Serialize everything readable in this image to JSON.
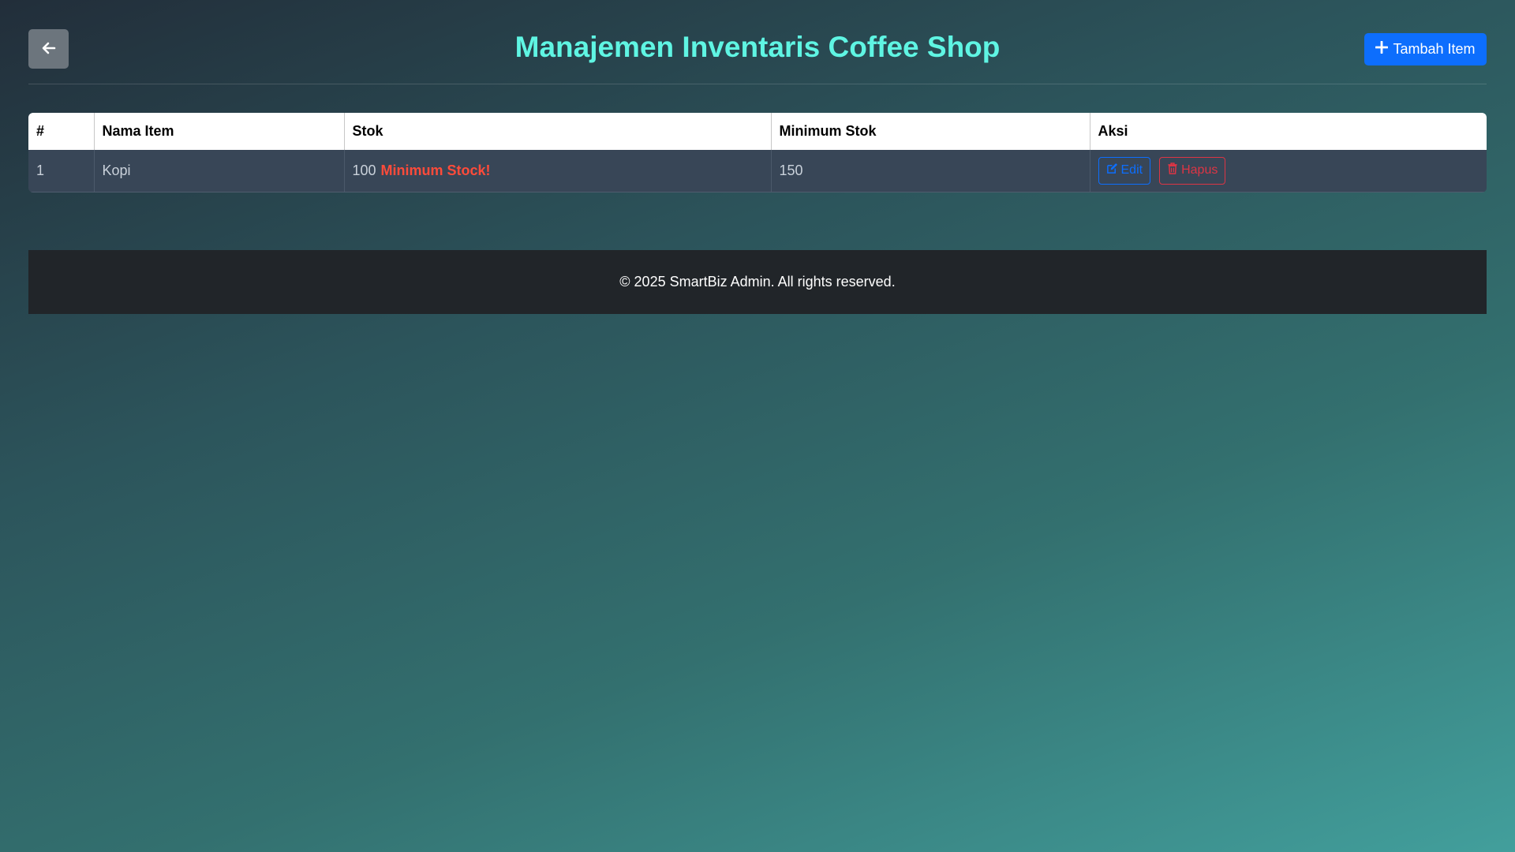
{
  "header": {
    "title": "Manajemen Inventaris Coffee Shop",
    "back_icon": "arrow-left-icon",
    "add_icon": "plus-icon",
    "add_label": "Tambah Item"
  },
  "table": {
    "columns": [
      "#",
      "Nama Item",
      "Stok",
      "Minimum Stok",
      "Aksi"
    ],
    "rows": [
      {
        "no": "1",
        "name": "Kopi",
        "stock": "100",
        "warning": "Minimum Stock!",
        "min_stock": "150",
        "edit_label": "Edit",
        "delete_label": "Hapus"
      }
    ]
  },
  "footer": {
    "text": "© 2025 SmartBiz Admin. All rights reserved."
  },
  "colors": {
    "title": "#5ff5e3",
    "primary": "#0d6efd",
    "danger": "#dc3545",
    "warning_text": "#ff4b3a",
    "footer_bg": "#212529"
  }
}
